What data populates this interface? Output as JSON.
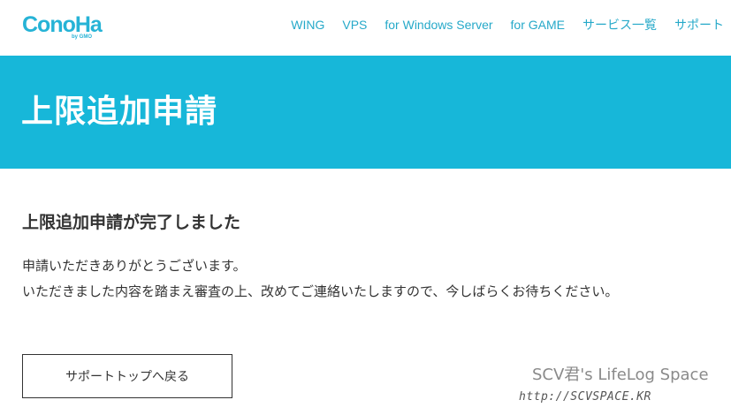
{
  "header": {
    "logo_text": "ConoHa",
    "logo_sub": "by GMO",
    "nav": [
      {
        "label": "WING"
      },
      {
        "label": "VPS"
      },
      {
        "label": "for Windows Server"
      },
      {
        "label": "for GAME"
      },
      {
        "label": "サービス一覧"
      },
      {
        "label": "サポート"
      }
    ]
  },
  "banner": {
    "title": "上限追加申請"
  },
  "main": {
    "heading": "上限追加申請が完了しました",
    "message_lines": [
      "申請いただきありがとうございます。",
      "いただきました内容を踏まえ審査の上、改めてご連絡いたしますので、今しばらくお待ちください。"
    ],
    "back_button_label": "サポートトップへ戻る"
  },
  "watermark": {
    "title": "SCV君's LifeLog Space",
    "url": "http://SCVSPACE.KR"
  },
  "colors": {
    "accent": "#17b7d9",
    "nav_text": "#26a9c9"
  }
}
